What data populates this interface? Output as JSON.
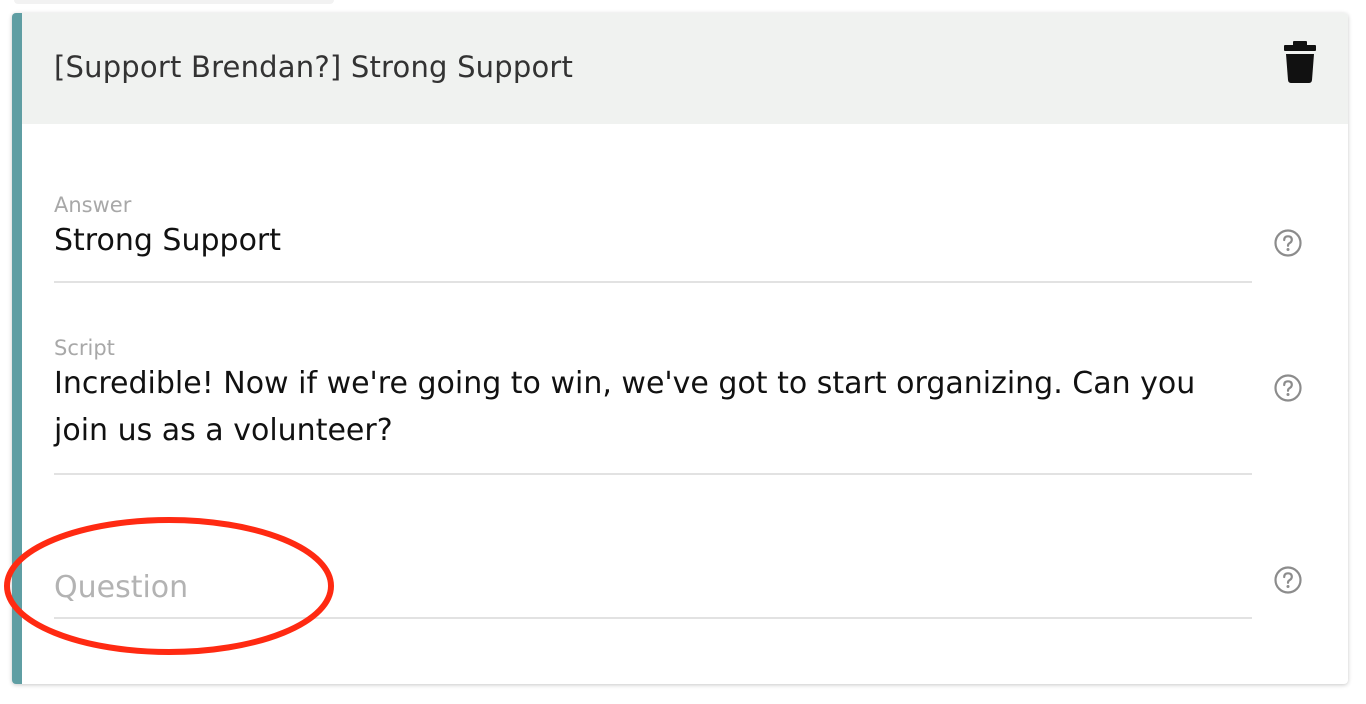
{
  "card": {
    "title": "[Support Brendan?] Strong Support",
    "accent_color": "#5f9ea3",
    "header_bg": "#f0f2f0"
  },
  "fields": {
    "answer": {
      "label": "Answer",
      "value": "Strong Support"
    },
    "script": {
      "label": "Script",
      "value": "Incredible! Now if we're going to win, we've got to start organizing. Can you join us as a volunteer?"
    },
    "question": {
      "placeholder": "Question",
      "value": ""
    }
  },
  "icons": {
    "delete": "trash-icon",
    "help": "question-circle-icon"
  },
  "annotation": {
    "type": "red-ellipse",
    "color": "#ff2a12",
    "target": "question-field"
  }
}
